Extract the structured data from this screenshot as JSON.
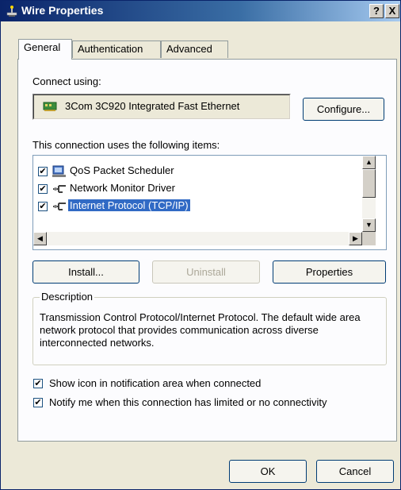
{
  "window": {
    "title": "Wire Properties",
    "help_glyph": "?",
    "close_glyph": "X"
  },
  "tabs": [
    {
      "label": "General",
      "active": true
    },
    {
      "label": "Authentication",
      "active": false
    },
    {
      "label": "Advanced",
      "active": false
    }
  ],
  "connect_using": {
    "label": "Connect using:",
    "adapter": "3Com 3C920 Integrated Fast Ethernet",
    "configure_button": "Configure..."
  },
  "items": {
    "label": "This connection uses the following items:",
    "list": [
      {
        "label": "QoS Packet Scheduler",
        "checked": true,
        "icon": "scheduler-icon"
      },
      {
        "label": "Network Monitor Driver",
        "checked": true,
        "icon": "network-protocol-icon"
      },
      {
        "label": "Internet Protocol (TCP/IP)",
        "checked": true,
        "icon": "network-protocol-icon",
        "selected": true
      }
    ],
    "check_glyph": "✔"
  },
  "actions": {
    "install": "Install...",
    "uninstall": "Uninstall",
    "properties": "Properties"
  },
  "description": {
    "title": "Description",
    "text": "Transmission Control Protocol/Internet Protocol. The default wide area network protocol that provides communication across diverse interconnected networks."
  },
  "options": {
    "show_icon": "Show icon in notification area when connected",
    "notify": "Notify me when this connection has limited or no connectivity"
  },
  "footer": {
    "ok": "OK",
    "cancel": "Cancel"
  }
}
